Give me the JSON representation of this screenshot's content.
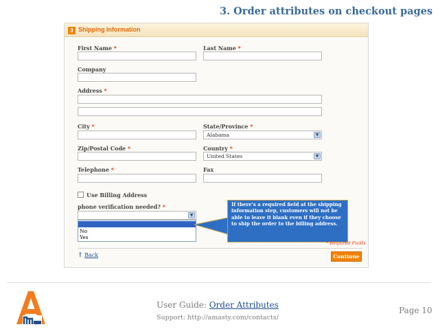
{
  "heading": "3. Order attributes on checkout pages",
  "panel": {
    "step_number": "3",
    "title": "Shipping Information",
    "required_mark": "*",
    "fields": {
      "first_name": "First Name",
      "last_name": "Last Name",
      "company": "Company",
      "address": "Address",
      "city": "City",
      "state": "State/Province",
      "zip": "Zip/Postal Code",
      "country": "Country",
      "telephone": "Telephone",
      "fax": "Fax"
    },
    "state_value": "Alabama",
    "country_value": "United States",
    "use_billing": "Use Billing Address",
    "phone_question": "phone verification needed?",
    "dropdown_options": [
      "",
      "No",
      "Yes"
    ],
    "required_fields_note": "* Required Fields",
    "back_arrow": "↑",
    "back_label": "Back",
    "continue_label": "Continue",
    "select_arrow": "▼"
  },
  "callout_text": "If there's a required field at the shipping information step, customers will not be able to leave it blank even if they choose to ship the order to the billing address.",
  "footer": {
    "guide_prefix": "User Guide: ",
    "guide_link": "Order Attributes",
    "support": "Support: http://amasty.com/contacts/",
    "page": "Page 10"
  },
  "colors": {
    "heading": "#3a6b9a",
    "accent_orange": "#f18200",
    "callout_blue": "#2e6fc4",
    "required_red": "#eb340a",
    "link_blue": "#1e4f98"
  }
}
